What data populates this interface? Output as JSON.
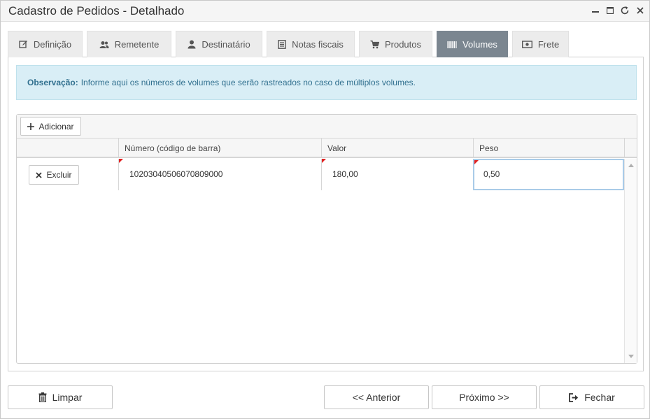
{
  "window": {
    "title": "Cadastro de Pedidos - Detalhado",
    "controls": {
      "minimize_icon": "minimize-icon",
      "maximize_icon": "maximize-icon",
      "refresh_icon": "refresh-icon",
      "close_icon": "close-icon"
    }
  },
  "tabs": [
    {
      "label": "Definição",
      "icon": "edit-icon",
      "active": false
    },
    {
      "label": "Remetente",
      "icon": "users-icon",
      "active": false
    },
    {
      "label": "Destinatário",
      "icon": "user-icon",
      "active": false
    },
    {
      "label": "Notas fiscais",
      "icon": "document-icon",
      "active": false
    },
    {
      "label": "Produtos",
      "icon": "cart-icon",
      "active": false
    },
    {
      "label": "Volumes",
      "icon": "barcode-icon",
      "active": true
    },
    {
      "label": "Frete",
      "icon": "money-icon",
      "active": false
    }
  ],
  "alert": {
    "label": "Observação:",
    "text": "Informe aqui os números de volumes que serão rastreados no caso de múltiplos volumes."
  },
  "grid": {
    "add_label": "Adicionar",
    "columns": [
      "Número (código de barra)",
      "Valor",
      "Peso"
    ],
    "rows": [
      {
        "delete_label": "Excluir",
        "numero": "10203040506070809000",
        "valor": "180,00",
        "peso": "0,50"
      }
    ]
  },
  "footer": {
    "clear_label": "Limpar",
    "prev_label": "<< Anterior",
    "next_label": "Próximo >>",
    "close_label": "Fechar"
  },
  "colors": {
    "active_tab": "#7b8690",
    "alert_bg": "#d9eef6",
    "alert_text": "#31708f",
    "dirty_marker": "#e02020"
  }
}
